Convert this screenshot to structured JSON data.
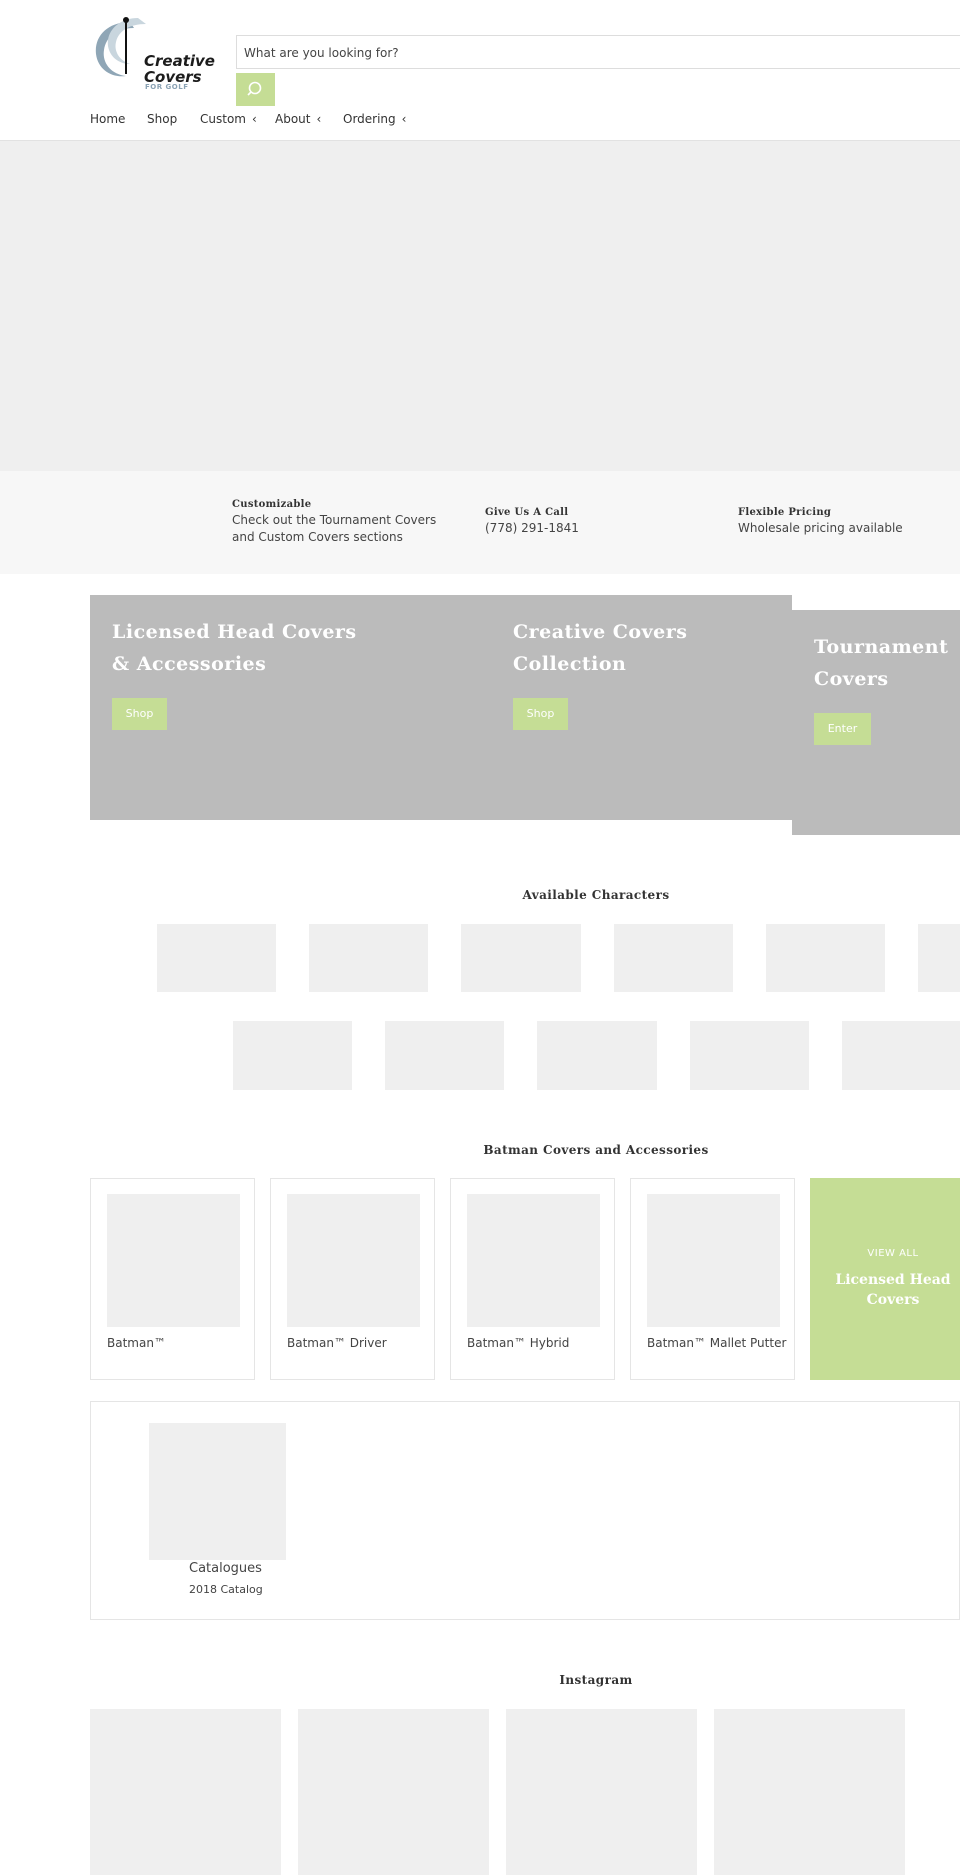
{
  "colors": {
    "accent": "#c5dd95",
    "placeholder": "#efefef",
    "promo_bg": "#bbbbbb",
    "infobar_bg": "#f7f7f7",
    "text": "#333333"
  },
  "brand": {
    "line1": "Creative",
    "line2": "Covers",
    "sub": "FOR GOLF"
  },
  "search": {
    "placeholder": "What are you looking for?",
    "icon": "search-icon"
  },
  "nav": {
    "home": "Home",
    "shop": "Shop",
    "custom": "Custom",
    "about": "About",
    "ordering": "Ordering",
    "chevron": "‹"
  },
  "info": [
    {
      "title": "Customizable",
      "text": "Check out the Tournament Covers and Custom Covers sections"
    },
    {
      "title": "Give Us A Call",
      "text": "(778) 291-1841"
    },
    {
      "title": "Flexible Pricing",
      "text": "Wholesale pricing available"
    }
  ],
  "promos": [
    {
      "title_l1": "Licensed Head Covers",
      "title_l2": "& Accessories",
      "button": "Shop"
    },
    {
      "title_l1": "Creative Covers",
      "title_l2": "Collection",
      "button": "Shop"
    },
    {
      "title_l1": "Tournament",
      "title_l2": "Covers",
      "button": "Enter"
    }
  ],
  "characters": {
    "heading": "Available Characters"
  },
  "batman": {
    "heading": "Batman Covers and Accessories",
    "products": [
      "Batman™",
      "Batman™ Driver",
      "Batman™ Hybrid",
      "Batman™ Mallet Putter"
    ],
    "view_all": {
      "kicker": "VIEW ALL",
      "title_l1": "Licensed Head",
      "title_l2": "Covers"
    }
  },
  "catalogues": {
    "title": "Catalogues",
    "item": "2018 Catalog"
  },
  "instagram": {
    "heading": "Instagram"
  }
}
